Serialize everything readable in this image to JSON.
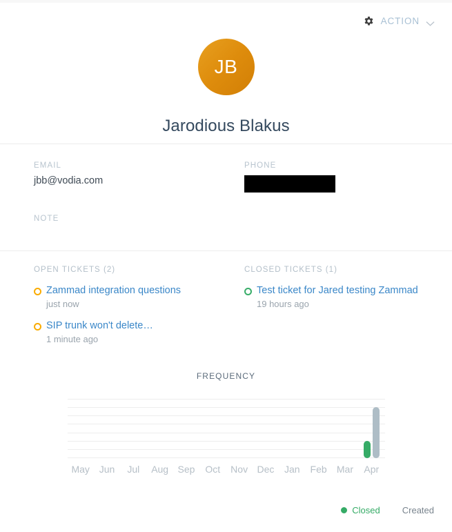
{
  "header": {
    "action_label": "ACTION",
    "gear_icon": "gear-icon",
    "chevron_icon": "chevron-down-icon"
  },
  "profile": {
    "initials": "JB",
    "name": "Jarodious Blakus",
    "avatar_color": "#de8c0c"
  },
  "attributes": {
    "email_label": "EMAIL",
    "email_value": "jbb@vodia.com",
    "phone_label": "PHONE",
    "phone_value": "",
    "note_label": "NOTE",
    "note_value": ""
  },
  "tickets": {
    "open": {
      "heading": "OPEN TICKETS (2)",
      "items": [
        {
          "title": "Zammad integration questions",
          "time": "just now",
          "state": "open"
        },
        {
          "title": "SIP trunk won't delete…",
          "time": "1 minute ago",
          "state": "open"
        }
      ]
    },
    "closed": {
      "heading": "CLOSED TICKETS (1)",
      "items": [
        {
          "title": "Test ticket for Jared testing Zammad",
          "time": "19 hours ago",
          "state": "closed"
        }
      ]
    }
  },
  "chart_data": {
    "type": "bar",
    "title": "FREQUENCY",
    "categories": [
      "May",
      "Jun",
      "Jul",
      "Aug",
      "Sep",
      "Oct",
      "Nov",
      "Dec",
      "Jan",
      "Feb",
      "Mar",
      "Apr"
    ],
    "series": [
      {
        "name": "Closed",
        "color": "#35ab66",
        "values": [
          0,
          0,
          0,
          0,
          0,
          0,
          0,
          0,
          0,
          0,
          0,
          1
        ]
      },
      {
        "name": "Created",
        "color": "#aebdc6",
        "values": [
          0,
          0,
          0,
          0,
          0,
          0,
          0,
          0,
          0,
          0,
          0,
          3
        ]
      }
    ],
    "ylim": [
      0,
      3.5
    ],
    "ylabel": "",
    "xlabel": "",
    "grid": true,
    "gridline_count": 8,
    "legend_position": "bottom-right"
  },
  "legend": {
    "closed_label": "Closed",
    "created_label": "Created"
  }
}
